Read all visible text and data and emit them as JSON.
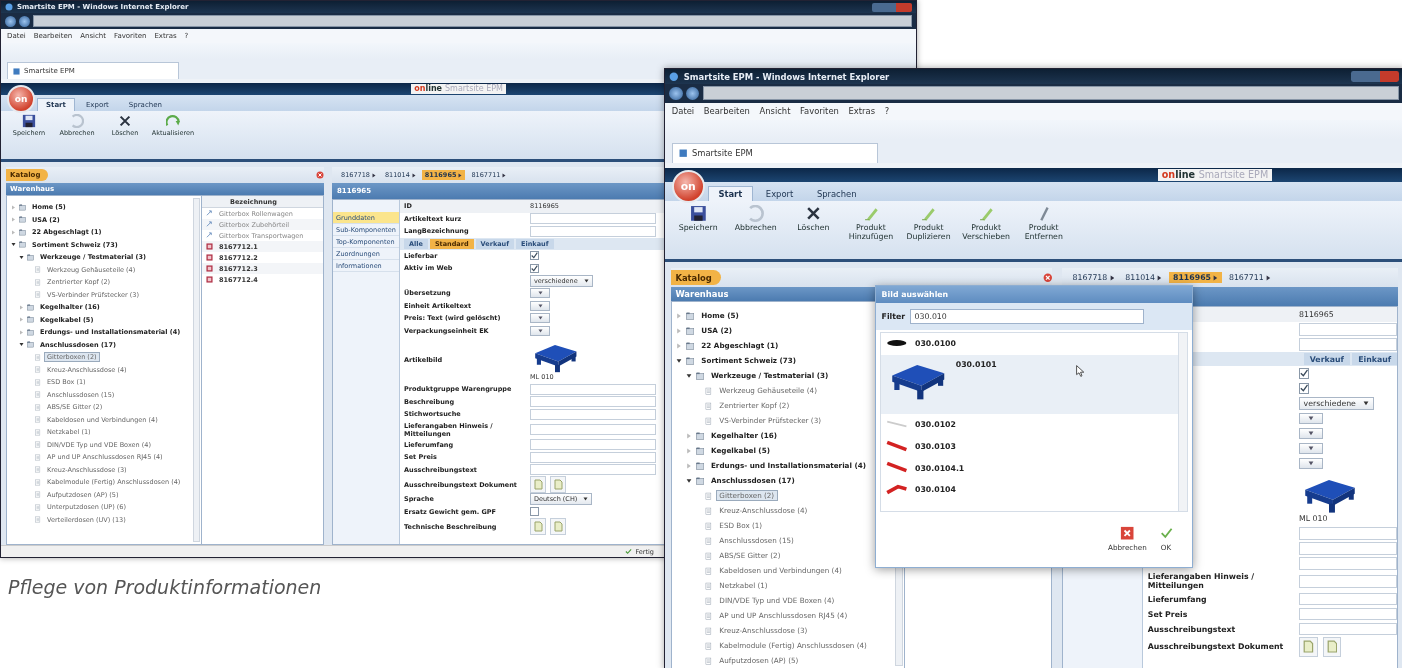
{
  "left_window": {
    "title": "Smartsite EPM - Windows Internet Explorer",
    "menu": [
      "Datei",
      "Bearbeiten",
      "Ansicht",
      "Favoriten",
      "Extras",
      "?"
    ],
    "tab": "Smartsite EPM",
    "app_button": "on",
    "logo": {
      "accent": "on",
      "rest": "line",
      "product": "Smartsite EPM"
    },
    "ribbon_tabs": [
      {
        "label": "Start",
        "selected": true
      },
      {
        "label": "Export",
        "selected": false
      },
      {
        "label": "Sprachen",
        "selected": false
      }
    ],
    "toolbar": [
      {
        "label": "Speichern",
        "kind": "save"
      },
      {
        "label": "Abbrechen",
        "kind": "undo"
      },
      {
        "label": "Löschen",
        "kind": "delete"
      },
      {
        "label": "Aktualisieren",
        "kind": "refresh"
      }
    ],
    "catalog": {
      "tag": "Katalog",
      "header": "Warenhaus",
      "tree": [
        {
          "label": "Home (5)",
          "kind": "folder",
          "expanded": false,
          "selected": false
        },
        {
          "label": "USA (2)",
          "kind": "folder",
          "expanded": false,
          "selected": false
        },
        {
          "label": "22 Abgeschlagt (1)",
          "kind": "folder",
          "expanded": false,
          "selected": false
        },
        {
          "label": "Sortiment Schweiz (73)",
          "kind": "folder",
          "expanded": true,
          "selected": false,
          "children": [
            {
              "label": "Werkzeuge / Testmaterial (3)",
              "kind": "folder",
              "expanded": true,
              "selected": false,
              "children": [
                {
                  "label": "Werkzeug Gehäuseteile (4)",
                  "kind": "leaf",
                  "selected": false
                },
                {
                  "label": "Zentrierter Kopf (2)",
                  "kind": "leaf",
                  "selected": false
                },
                {
                  "label": "VS-Verbinder Prüfstecker (3)",
                  "kind": "leaf",
                  "selected": false
                }
              ]
            },
            {
              "label": "Kegelhalter (16)",
              "kind": "folder",
              "expanded": false,
              "selected": false
            },
            {
              "label": "Kegelkabel (5)",
              "kind": "folder",
              "expanded": false,
              "selected": false
            },
            {
              "label": "Erdungs- und Installationsmaterial (4)",
              "kind": "folder",
              "expanded": false,
              "selected": false
            },
            {
              "label": "Anschlussdosen (17)",
              "kind": "folder",
              "expanded": true,
              "selected": false,
              "children": [
                {
                  "label": "Gitterboxen (2)",
                  "kind": "leaf",
                  "selected": true
                },
                {
                  "label": "Kreuz-Anschlussdose (4)",
                  "kind": "leaf",
                  "selected": false
                },
                {
                  "label": "ESD Box (1)",
                  "kind": "leaf",
                  "selected": false
                },
                {
                  "label": "Anschlussdosen (15)",
                  "kind": "leaf",
                  "selected": false
                },
                {
                  "label": "ABS/SE Gitter (2)",
                  "kind": "leaf",
                  "selected": false
                },
                {
                  "label": "Kabeldosen und Verbindungen (4)",
                  "kind": "leaf",
                  "selected": false
                },
                {
                  "label": "Netzkabel (1)",
                  "kind": "leaf",
                  "selected": false
                },
                {
                  "label": "DIN/VDE Typ und VDE Boxen (4)",
                  "kind": "leaf",
                  "selected": false
                },
                {
                  "label": "AP und UP Anschlussdosen RJ45 (4)",
                  "kind": "leaf",
                  "selected": false
                },
                {
                  "label": "Kreuz-Anschlussdose (3)",
                  "kind": "leaf",
                  "selected": false
                },
                {
                  "label": "Kabelmodule (Fertig) Anschlussdosen (4)",
                  "kind": "leaf",
                  "selected": false
                },
                {
                  "label": "Aufputzdosen (AP) (5)",
                  "kind": "leaf",
                  "selected": false
                },
                {
                  "label": "Unterputzdosen (UP) (6)",
                  "kind": "leaf",
                  "selected": false
                },
                {
                  "label": "Verteilerdosen (UV) (13)",
                  "kind": "leaf",
                  "selected": false
                }
              ]
            }
          ]
        }
      ],
      "list": {
        "column": "Bezeichnung",
        "rows": [
          {
            "label": "Gitterbox Rollenwagen",
            "kind": "link",
            "selected": false
          },
          {
            "label": "Gitterbox Zubehörteil",
            "kind": "link",
            "selected": false
          },
          {
            "label": "Gitterbox Transportwagen",
            "kind": "link",
            "selected": false
          },
          {
            "label": "8167712.1",
            "kind": "article",
            "selected": false
          },
          {
            "label": "8167712.2",
            "kind": "article",
            "selected": false
          },
          {
            "label": "8167712.3",
            "kind": "article",
            "selected": false
          },
          {
            "label": "8167712.4",
            "kind": "article",
            "selected": false
          }
        ]
      }
    },
    "detail": {
      "breadcrumbs": [
        {
          "label": "8167718",
          "selected": false
        },
        {
          "label": "811014",
          "selected": false
        },
        {
          "label": "8116965",
          "selected": true
        },
        {
          "label": "8167711",
          "selected": false
        }
      ],
      "header": "8116965",
      "nav": [
        {
          "label": "Grunddaten",
          "selected": true
        },
        {
          "label": "Sub-Komponenten",
          "selected": false
        },
        {
          "label": "Top-Komponenten",
          "selected": false
        },
        {
          "label": "Zuordnungen",
          "selected": false
        },
        {
          "label": "Informationen",
          "selected": false
        }
      ],
      "form": {
        "top": [
          {
            "kind": "value",
            "label": "ID",
            "value": "8116965"
          },
          {
            "kind": "text",
            "label": "Artikeltext kurz"
          },
          {
            "kind": "text",
            "label": "LangBezeichnung"
          }
        ],
        "subtabs": [
          {
            "label": "Alle",
            "selected": false
          },
          {
            "label": "Standard",
            "selected": true
          },
          {
            "label": "Verkauf",
            "selected": false
          },
          {
            "label": "Einkauf",
            "selected": false
          }
        ],
        "rows": [
          {
            "kind": "check",
            "label": "Lieferbar",
            "checked": true
          },
          {
            "kind": "check",
            "label": "Aktiv im Web",
            "checked": true
          },
          {
            "kind": "select",
            "value": "verschiedene"
          },
          {
            "kind": "button",
            "label": "Übersetzung"
          },
          {
            "kind": "button",
            "label": "Einheit Artikeltext"
          },
          {
            "kind": "button",
            "label": "Preis: Text (wird gelöscht)"
          },
          {
            "kind": "button",
            "label": "Verpackungseinheit EK"
          },
          {
            "kind": "image",
            "label": "Artikelbild",
            "caption": "ML 010"
          },
          {
            "kind": "text",
            "label": "Produktgruppe Warengruppe"
          },
          {
            "kind": "text",
            "label": "Beschreibung"
          },
          {
            "kind": "text",
            "label": "Stichwortsuche"
          },
          {
            "kind": "text",
            "label": "Lieferangaben Hinweis / Mitteilungen"
          },
          {
            "kind": "text",
            "label": "Lieferumfang"
          },
          {
            "kind": "text",
            "label": "Set Preis"
          },
          {
            "kind": "text",
            "label": "Ausschreibungstext"
          },
          {
            "kind": "docs",
            "label": "Ausschreibungstext Dokument"
          },
          {
            "kind": "select",
            "label": "Sprache",
            "value": "Deutsch (CH)"
          },
          {
            "kind": "check",
            "label": "Ersatz Gewicht gem. GPF",
            "checked": false
          },
          {
            "kind": "docs",
            "label": "Technische Beschreibung"
          }
        ]
      }
    },
    "status": "Fertig"
  },
  "right_window": {
    "title": "Smartsite EPM - Windows Internet Explorer",
    "menu": [
      "Datei",
      "Bearbeiten",
      "Ansicht",
      "Favoriten",
      "Extras",
      "?"
    ],
    "tab": "Smartsite EPM",
    "app_button": "on",
    "logo": {
      "accent": "on",
      "rest": "line",
      "product": "Smartsite EPM"
    },
    "ribbon_tabs": [
      {
        "label": "Start",
        "selected": true
      },
      {
        "label": "Export",
        "selected": false
      },
      {
        "label": "Sprachen",
        "selected": false
      }
    ],
    "toolbar": [
      {
        "label": "Speichern",
        "kind": "save"
      },
      {
        "label": "Abbrechen",
        "kind": "undo"
      },
      {
        "label": "Löschen",
        "kind": "delete"
      },
      {
        "label": "Produkt Hinzufügen",
        "kind": "add"
      },
      {
        "label": "Produkt Duplizieren",
        "kind": "add"
      },
      {
        "label": "Produkt Verschieben",
        "kind": "add"
      },
      {
        "label": "Produkt Entfernen",
        "kind": "edit"
      }
    ],
    "catalog": {
      "tag": "Katalog",
      "header": "Warenhaus",
      "tree": [
        {
          "label": "Home (5)",
          "kind": "folder",
          "expanded": false,
          "selected": false
        },
        {
          "label": "USA (2)",
          "kind": "folder",
          "expanded": false,
          "selected": false
        },
        {
          "label": "22 Abgeschlagt (1)",
          "kind": "folder",
          "expanded": false,
          "selected": false
        },
        {
          "label": "Sortiment Schweiz (73)",
          "kind": "folder",
          "expanded": true,
          "selected": false,
          "children": [
            {
              "label": "Werkzeuge / Testmaterial (3)",
              "kind": "folder",
              "expanded": true,
              "selected": false,
              "children": [
                {
                  "label": "Werkzeug Gehäuseteile (4)",
                  "kind": "leaf",
                  "selected": false
                },
                {
                  "label": "Zentrierter Kopf (2)",
                  "kind": "leaf",
                  "selected": false
                },
                {
                  "label": "VS-Verbinder Prüfstecker (3)",
                  "kind": "leaf",
                  "selected": false
                }
              ]
            },
            {
              "label": "Kegelhalter (16)",
              "kind": "folder",
              "expanded": false,
              "selected": false
            },
            {
              "label": "Kegelkabel (5)",
              "kind": "folder",
              "expanded": false,
              "selected": false
            },
            {
              "label": "Erdungs- und Installationsmaterial (4)",
              "kind": "folder",
              "expanded": false,
              "selected": false
            },
            {
              "label": "Anschlussdosen (17)",
              "kind": "folder",
              "expanded": true,
              "selected": false,
              "children": [
                {
                  "label": "Gitterboxen (2)",
                  "kind": "leaf",
                  "selected": true
                },
                {
                  "label": "Kreuz-Anschlussdose (4)",
                  "kind": "leaf",
                  "selected": false
                },
                {
                  "label": "ESD Box (1)",
                  "kind": "leaf",
                  "selected": false
                },
                {
                  "label": "Anschlussdosen (15)",
                  "kind": "leaf",
                  "selected": false
                },
                {
                  "label": "ABS/SE Gitter (2)",
                  "kind": "leaf",
                  "selected": false
                },
                {
                  "label": "Kabeldosen und Verbindungen (4)",
                  "kind": "leaf",
                  "selected": false
                },
                {
                  "label": "Netzkabel (1)",
                  "kind": "leaf",
                  "selected": false
                },
                {
                  "label": "DIN/VDE Typ und VDE Boxen (4)",
                  "kind": "leaf",
                  "selected": false
                },
                {
                  "label": "AP und UP Anschlussdosen RJ45 (4)",
                  "kind": "leaf",
                  "selected": false
                },
                {
                  "label": "Kreuz-Anschlussdose (3)",
                  "kind": "leaf",
                  "selected": false
                },
                {
                  "label": "Kabelmodule (Fertig) Anschlussdosen (4)",
                  "kind": "leaf",
                  "selected": false
                },
                {
                  "label": "Aufputzdosen (AP) (5)",
                  "kind": "leaf",
                  "selected": false
                }
              ]
            }
          ]
        }
      ]
    },
    "detail": {
      "breadcrumbs": [
        {
          "label": "8167718",
          "selected": false
        },
        {
          "label": "811014",
          "selected": false
        },
        {
          "label": "8116965",
          "selected": true
        },
        {
          "label": "8167711",
          "selected": false
        }
      ],
      "form": {
        "top": [
          {
            "kind": "value",
            "value": "8116965"
          },
          {
            "kind": "text"
          },
          {
            "kind": "text"
          }
        ],
        "subtabs": [
          {
            "label": "Verkauf",
            "selected": false
          },
          {
            "label": "Einkauf",
            "selected": false
          }
        ],
        "rows": [
          {
            "kind": "check",
            "checked": true
          },
          {
            "kind": "check",
            "checked": true
          },
          {
            "kind": "select",
            "value": "verschiedene"
          },
          {
            "kind": "button"
          },
          {
            "kind": "button"
          },
          {
            "kind": "button"
          },
          {
            "kind": "button"
          },
          {
            "kind": "image",
            "caption": "ML 010"
          },
          {
            "kind": "text"
          },
          {
            "kind": "text"
          },
          {
            "kind": "text"
          },
          {
            "kind": "text",
            "label": "Lieferangaben Hinweis / Mitteilungen"
          },
          {
            "kind": "text",
            "label": "Lieferumfang"
          },
          {
            "kind": "text",
            "label": "Set Preis"
          },
          {
            "kind": "text",
            "label": "Ausschreibungstext"
          },
          {
            "kind": "docs",
            "label": "Ausschreibungstext Dokument"
          }
        ]
      }
    },
    "dialog": {
      "title": "Bild auswählen",
      "filter_label": "Filter",
      "filter_value": "030.010",
      "items": [
        {
          "label": "030.0100",
          "kind": "clip",
          "selected": false
        },
        {
          "label": "030.0101",
          "kind": "pallet",
          "selected": true
        },
        {
          "label": "030.0102",
          "kind": "wire",
          "selected": false
        },
        {
          "label": "030.0103",
          "kind": "strip",
          "selected": false
        },
        {
          "label": "030.0104.1",
          "kind": "strip",
          "selected": false
        },
        {
          "label": "030.0104",
          "kind": "plug",
          "selected": false
        }
      ],
      "buttons": [
        {
          "label": "Abbrechen",
          "kind": "cancel"
        },
        {
          "label": "OK",
          "kind": "ok"
        }
      ]
    }
  },
  "caption": "Pflege von Produktinformationen"
}
